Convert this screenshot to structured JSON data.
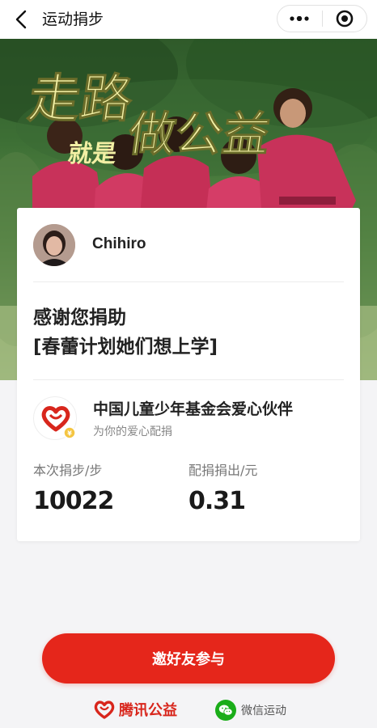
{
  "navbar": {
    "title": "运动捐步"
  },
  "hero": {
    "slogan_line1": "走路",
    "slogan_line2_small": "就是",
    "slogan_line2_big": "做公益"
  },
  "user": {
    "name": "Chihiro"
  },
  "thanks": {
    "line1": "感谢您捐助",
    "line2": "[春蕾计划她们想上学]"
  },
  "partner": {
    "name": "中国儿童少年基金会爱心伙伴",
    "subtitle": "为你的爱心配捐"
  },
  "stats": {
    "steps_label": "本次捐步/步",
    "steps_value": "10022",
    "amount_label": "配捐捐出/元",
    "amount_value": "0.31"
  },
  "cta": {
    "label": "邀好友参与"
  },
  "footer": {
    "brand_left": "腾讯公益",
    "brand_right": "微信运动"
  },
  "colors": {
    "accent_red": "#e5261b",
    "brand_red": "#d8261c",
    "wechat_green": "#1aad19"
  }
}
